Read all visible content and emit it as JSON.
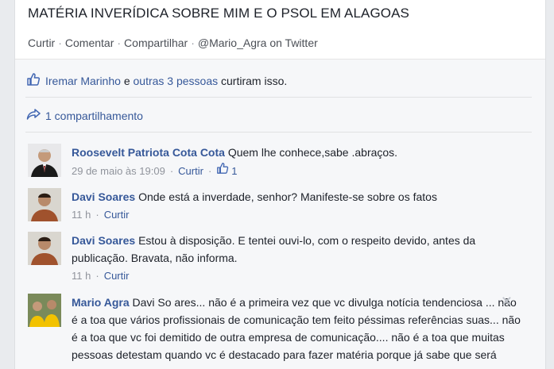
{
  "post": {
    "title": "MATÉRIA INVERÍDICA SOBRE MIM E O PSOL EM ALAGOAS",
    "actions": {
      "like": "Curtir",
      "comment": "Comentar",
      "share": "Compartilhar",
      "twitter": "@Mario_Agra on Twitter"
    }
  },
  "likes": {
    "name": "Iremar Marinho",
    "and": "e",
    "others": "outras 3 pessoas",
    "suffix": "curtiram isso."
  },
  "shares": {
    "text": "1 compartilhamento"
  },
  "comments": [
    {
      "author": "Roosevelt Patriota Cota Cota",
      "text": "Quem lhe conhece,sabe .abraços.",
      "time": "29 de maio às 19:09",
      "like": "Curtir",
      "like_count": "1"
    },
    {
      "author": "Davi Soares",
      "text": "Onde está a inverdade, senhor? Manifeste-se sobre os fatos",
      "time": "11 h",
      "like": "Curtir"
    },
    {
      "author": "Davi Soares",
      "text": "Estou à disposição. E tentei ouvi-lo, com o respeito devido, antes da publicação. Bravata, não informa.",
      "time": "11 h",
      "like": "Curtir"
    },
    {
      "author": "Mario Agra",
      "text": "Davi So ares... não é a primeira vez que vc divulga notícia tendenciosa ... não é a toa que vários profissionais de comunicação tem feito péssimas referências suas... não é a toa que vc foi demitido de outra empresa de comunicação.... não é a toa que muitas pessoas detestam quando vc é destacado para fazer matéria porque já sabe que será"
    }
  ],
  "colors": {
    "link": "#365899",
    "meta": "#90949c",
    "background": "#e9ebee"
  }
}
